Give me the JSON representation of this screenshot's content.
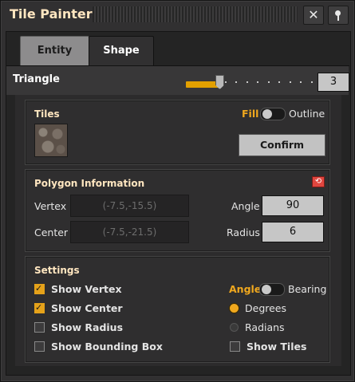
{
  "window": {
    "title": "Tile Painter"
  },
  "tabs": [
    {
      "label": "Entity",
      "selected": false
    },
    {
      "label": "Shape",
      "selected": true
    }
  ],
  "shape": {
    "name": "Triangle",
    "sides_value": "3",
    "sides_level": 0.04
  },
  "tiles_panel": {
    "title": "Tiles",
    "tile_icon": "stone-path-tile-icon",
    "fill_label": "Fill",
    "outline_label": "Outline",
    "confirm_label": "Confirm"
  },
  "polygon_panel": {
    "title": "Polygon Information",
    "vertex_label": "Vertex",
    "vertex_value": "(-7.5,-15.5)",
    "center_label": "Center",
    "center_value": "(-7.5,-21.5)",
    "angle_label": "Angle",
    "angle_value": "90",
    "radius_label": "Radius",
    "radius_value": "6",
    "reset_icon": "reset-icon"
  },
  "settings_panel": {
    "title": "Settings",
    "checkboxes": [
      {
        "label": "Show Vertex",
        "checked": true
      },
      {
        "label": "Show Center",
        "checked": true
      },
      {
        "label": "Show Radius",
        "checked": false
      },
      {
        "label": "Show Bounding Box",
        "checked": false
      }
    ],
    "angle_label": "Angle",
    "bearing_label": "Bearing",
    "units": [
      {
        "label": "Degrees",
        "selected": true
      },
      {
        "label": "Radians",
        "selected": false
      }
    ],
    "show_tiles_label": "Show Tiles",
    "show_tiles_checked": false
  },
  "colors": {
    "accent": "#f0a81e",
    "title_text": "#ffe6c0",
    "window_bg": "#313031"
  }
}
